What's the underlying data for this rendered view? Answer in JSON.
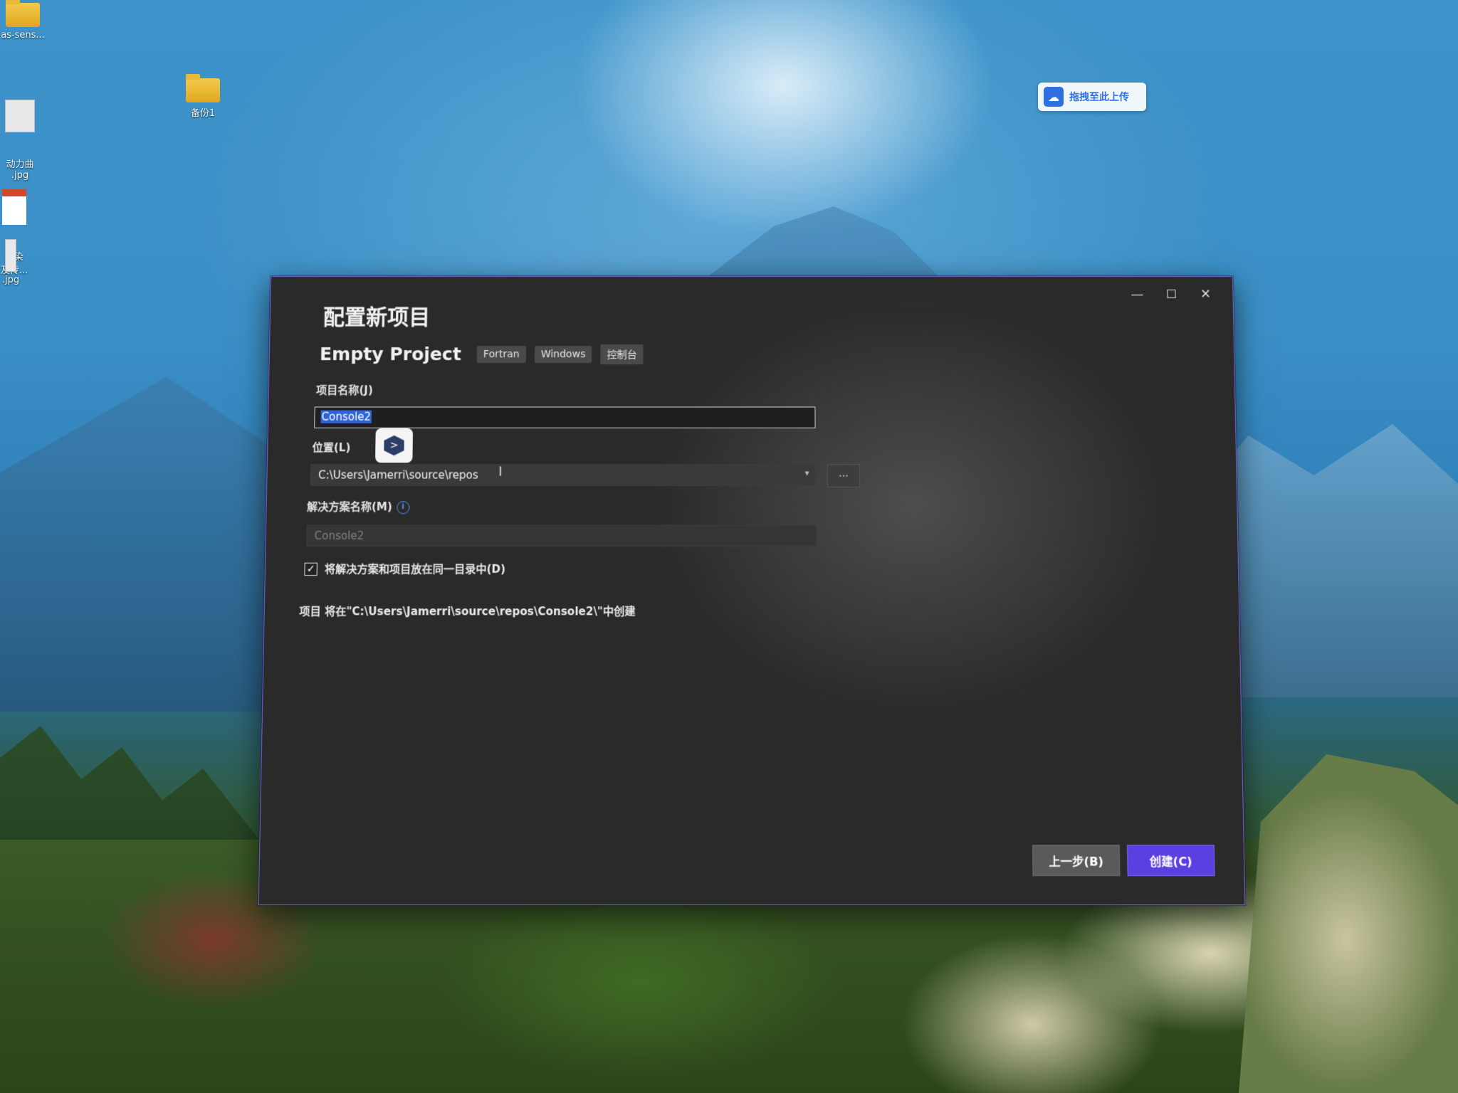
{
  "desktop": {
    "icons": [
      {
        "label": "as-sens..."
      },
      {
        "label": "备份1"
      },
      {
        "label": "动力曲\n.jpg"
      },
      {
        "label": "传染\n及传..."
      },
      {
        "label": ".jpg"
      }
    ],
    "upload_label": "拖拽至此上传"
  },
  "dialog": {
    "title": "配置新项目",
    "project_type": "Empty Project",
    "tags": [
      "Fortran",
      "Windows",
      "控制台"
    ],
    "project_name_label": "项目名称(J)",
    "project_name_value": "Console2",
    "location_label": "位置(L)",
    "location_value": "C:\\Users\\Jamerri\\source\\repos",
    "browse_label": "...",
    "solution_name_label": "解决方案名称(M)",
    "solution_name_placeholder": "Console2",
    "same_dir_label": "将解决方案和项目放在同一目录中(D)",
    "same_dir_checked": true,
    "path_note": "项目 将在\"C:\\Users\\Jamerri\\source\\repos\\Console2\\\"中创建",
    "back_button": "上一步(B)",
    "create_button": "创建(C)",
    "window_controls": {
      "minimize": "—",
      "close": "✕"
    }
  },
  "colors": {
    "accent": "#5b3fe0",
    "selection": "#2f64d6",
    "info": "#5b8def"
  }
}
